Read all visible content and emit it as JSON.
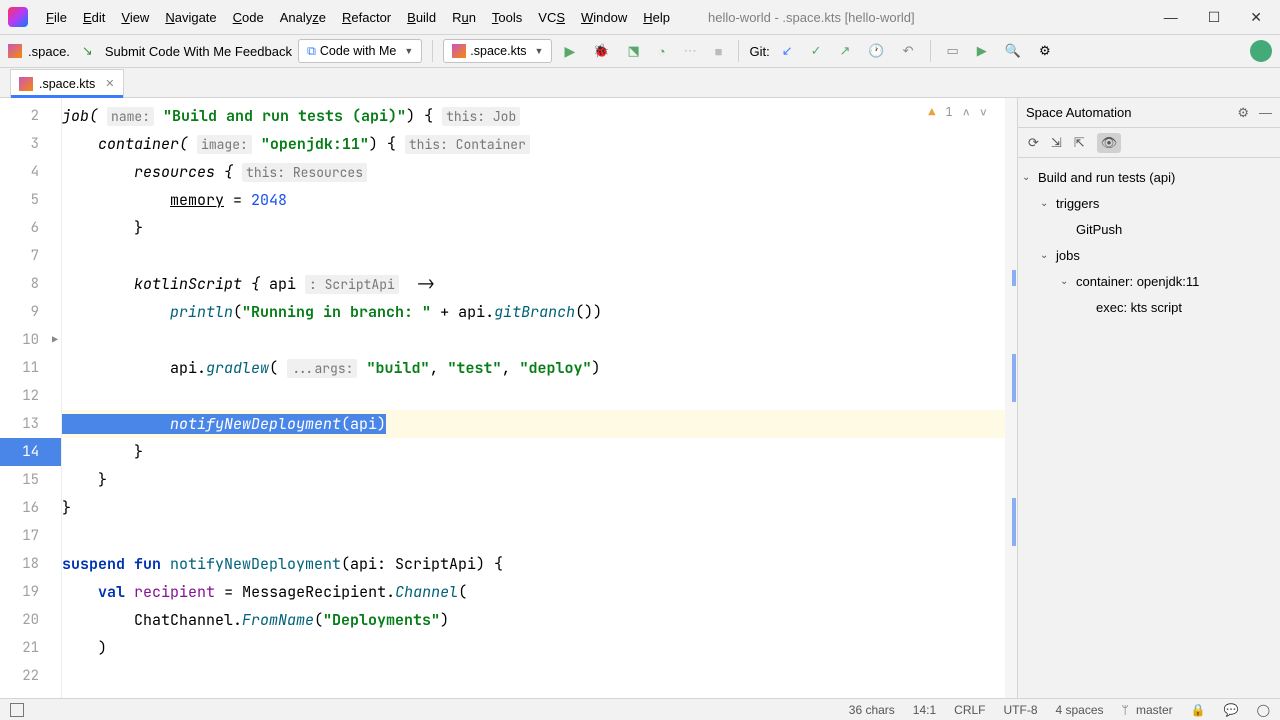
{
  "menu": {
    "file": "File",
    "edit": "Edit",
    "view": "View",
    "navigate": "Navigate",
    "code": "Code",
    "analyze": "Analyze",
    "refactor": "Refactor",
    "build": "Build",
    "run": "Run",
    "tools": "Tools",
    "vcs": "VCS",
    "window": "Window",
    "help": "Help"
  },
  "title": "hello-world - .space.kts [hello-world]",
  "toolbar": {
    "breadcrumb": ".space.",
    "submit": "Submit Code With Me Feedback",
    "codewithme": "Code with Me",
    "runconfig": ".space.kts",
    "git": "Git:"
  },
  "tab": {
    "name": ".space.kts"
  },
  "gutter": {
    "start": 2,
    "end": 22,
    "play_line": 10,
    "sel_line": 14
  },
  "code": {
    "l2": "job( ",
    "l2h": "name:",
    "l2a": " ",
    "l2s": "\"Build and run tests (api)\"",
    "l2b": ") { ",
    "l2h2": "this: Job",
    "l3": "    container( ",
    "l3h": "image:",
    "l3a": " ",
    "l3s": "\"openjdk:11\"",
    "l3b": ") { ",
    "l3h2": "this: Container",
    "l4": "        resources { ",
    "l4h": "this: Resources",
    "l5": "            ",
    "l5m": "memory",
    "l5a": " = ",
    "l5n": "2048",
    "l6": "        }",
    "l7": "",
    "l8": "        kotlinScript { ",
    "l8a": "api ",
    "l8h": ": ScriptApi",
    "l8b": "  ->",
    "l9": "            ",
    "l9f": "println",
    "l9a": "(",
    "l9s": "\"Running in branch: \"",
    "l9b": " + api.",
    "l9c": "gitBranch",
    "l9d": "())",
    "l10": "",
    "l11": "            api.",
    "l11f": "gradlew",
    "l11a": "( ",
    "l11h": "...args:",
    "l11b": " ",
    "l11s1": "\"build\"",
    "l11c": ", ",
    "l11s2": "\"test\"",
    "l11d": ", ",
    "l11s3": "\"deploy\"",
    "l11e": ")",
    "l12": "",
    "l13a": "            ",
    "l13f": "notifyNewDeployment",
    "l13b": "(api)",
    "l14": "        }",
    "l15": "    }",
    "l16": "}",
    "l17": "",
    "l18a": "suspend fun",
    "l18b": " ",
    "l18f": "notifyNewDeployment",
    "l18c": "(api: ScriptApi) {",
    "l19a": "    ",
    "l19k": "val",
    "l19b": " ",
    "l19v": "recipient",
    "l19c": " = MessageRecipient.",
    "l19f": "Channel",
    "l19d": "(",
    "l20a": "        ChatChannel.",
    "l20f": "FromName",
    "l20b": "(",
    "l20s": "\"Deployments\"",
    "l20c": ")",
    "l21": "    )"
  },
  "warn": {
    "count": "1"
  },
  "panel": {
    "title": "Space Automation",
    "root": "Build and run tests (api)",
    "triggers": "triggers",
    "gitpush": "GitPush",
    "jobs": "jobs",
    "container": "container: openjdk:11",
    "exec": "exec: kts script"
  },
  "status": {
    "chars": "36 chars",
    "pos": "14:1",
    "eol": "CRLF",
    "enc": "UTF-8",
    "indent": "4 spaces",
    "branch": "master"
  }
}
